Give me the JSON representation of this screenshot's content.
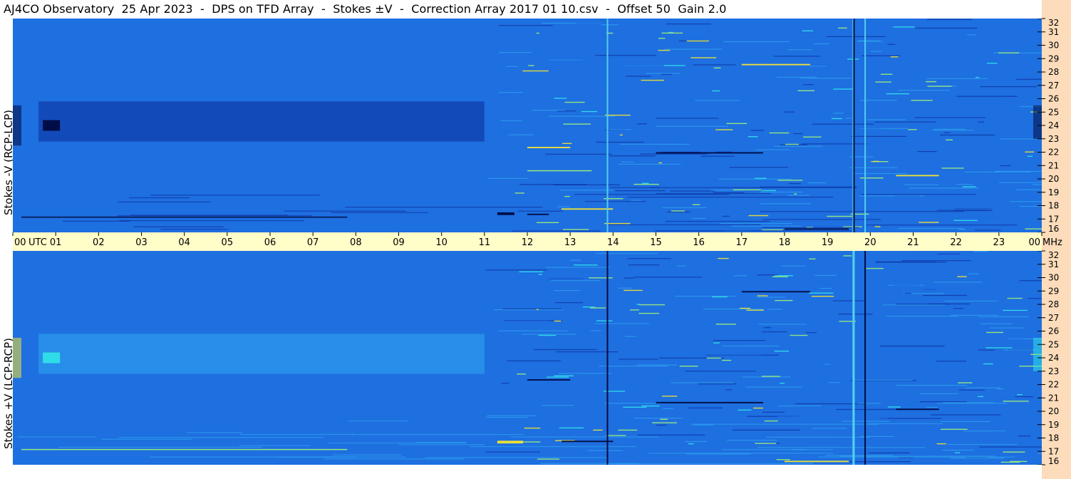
{
  "header": {
    "title": "AJ4CO Observatory  25 Apr 2023  -  DPS on TFD Array  -  Stokes ±V  -  Correction Array 2017 01 10.csv  -  Offset 50  Gain 2.0"
  },
  "colors": {
    "background_blue": "#1E6FE0",
    "right_strip": "#FCDCBA",
    "time_axis_band": "#FFFDC8",
    "feature_yellow": "#F4E430",
    "feature_cyan": "#30E0E8",
    "feature_dark": "#000A40"
  },
  "chart_data": [
    {
      "type": "heatmap",
      "ylabel": "Stokes -V (RCP-LCP)",
      "x": {
        "unit": "UTC",
        "range": [
          0,
          24
        ],
        "tick_labels": [
          "00",
          "01",
          "02",
          "03",
          "04",
          "05",
          "06",
          "07",
          "08",
          "09",
          "10",
          "11",
          "12",
          "13",
          "14",
          "15",
          "16",
          "17",
          "18",
          "19",
          "20",
          "21",
          "22",
          "23",
          "00"
        ]
      },
      "y": {
        "unit": "MHz",
        "range": [
          16,
          32
        ],
        "tick_labels": [
          "16",
          "17",
          "18",
          "19",
          "20",
          "21",
          "22",
          "23",
          "24",
          "25",
          "26",
          "27",
          "28",
          "29",
          "30",
          "31",
          "32"
        ]
      },
      "colormap": [
        "#000A40",
        "#0B2C9A",
        "#1E6FE0",
        "#2FA8F0",
        "#30E0E8",
        "#9EF078",
        "#F4E430"
      ],
      "vertical_lines_utc": [
        {
          "x": 13.87,
          "color": "#50D0F0"
        },
        {
          "x": 19.6,
          "color": "#50D0F0"
        },
        {
          "x": 19.62,
          "color": "#000A40"
        },
        {
          "x": 19.88,
          "color": "#50D0F0"
        }
      ],
      "features": [
        {
          "x0": 0.6,
          "x1": 11.0,
          "y0": 22.8,
          "y1": 25.8,
          "level": 1
        },
        {
          "x0": 0.7,
          "x1": 1.1,
          "y0": 23.6,
          "y1": 24.4,
          "level": 0
        },
        {
          "x0": 0.0,
          "x1": 0.2,
          "y0": 22.5,
          "y1": 25.5,
          "level": 0
        },
        {
          "x0": 23.8,
          "x1": 24.0,
          "y0": 23.0,
          "y1": 25.5,
          "level": 0
        },
        {
          "x0": 17.0,
          "x1": 18.6,
          "y0": 28.5,
          "y1": 28.6,
          "level": 6
        },
        {
          "x0": 20.6,
          "x1": 21.6,
          "y0": 20.2,
          "y1": 20.3,
          "level": 6
        },
        {
          "x0": 18.0,
          "x1": 19.5,
          "y0": 16.2,
          "y1": 16.3,
          "level": 0
        },
        {
          "x0": 11.3,
          "x1": 11.7,
          "y0": 17.3,
          "y1": 17.5,
          "level": 0
        },
        {
          "x0": 12.0,
          "x1": 12.5,
          "y0": 17.3,
          "y1": 17.4,
          "level": 0
        },
        {
          "x0": 0.2,
          "x1": 7.8,
          "y0": 17.1,
          "y1": 17.18,
          "level": 0
        },
        {
          "x0": 12.8,
          "x1": 14.0,
          "y0": 17.7,
          "y1": 17.8,
          "level": 6
        },
        {
          "x0": 12.0,
          "x1": 13.5,
          "y0": 20.6,
          "y1": 20.65,
          "level": 5
        },
        {
          "x0": 15.0,
          "x1": 17.5,
          "y0": 21.9,
          "y1": 22.0,
          "level": 0
        },
        {
          "x0": 12.0,
          "x1": 13.0,
          "y0": 22.3,
          "y1": 22.4,
          "level": 6
        }
      ]
    },
    {
      "type": "heatmap",
      "ylabel": "Stokes +V (LCP-RCP)",
      "x": {
        "unit": "UTC",
        "range": [
          0,
          24
        ],
        "tick_labels": [
          "00",
          "01",
          "02",
          "03",
          "04",
          "05",
          "06",
          "07",
          "08",
          "09",
          "10",
          "11",
          "12",
          "13",
          "14",
          "15",
          "16",
          "17",
          "18",
          "19",
          "20",
          "21",
          "22",
          "23",
          "00"
        ]
      },
      "y": {
        "unit": "MHz",
        "range": [
          16,
          32
        ],
        "tick_labels": [
          "16",
          "17",
          "18",
          "19",
          "20",
          "21",
          "22",
          "23",
          "24",
          "25",
          "26",
          "27",
          "28",
          "29",
          "30",
          "31",
          "32"
        ]
      },
      "colormap": [
        "#000A40",
        "#0B2C9A",
        "#1E6FE0",
        "#2FA8F0",
        "#30E0E8",
        "#9EF078",
        "#F4E430"
      ],
      "vertical_lines_utc": [
        {
          "x": 13.87,
          "color": "#000A40"
        },
        {
          "x": 19.6,
          "color": "#50D0F0"
        },
        {
          "x": 19.62,
          "color": "#50D0F0"
        },
        {
          "x": 19.88,
          "color": "#000A40"
        }
      ],
      "features": [
        {
          "x0": 0.6,
          "x1": 11.0,
          "y0": 22.8,
          "y1": 25.8,
          "level": 3
        },
        {
          "x0": 0.7,
          "x1": 1.1,
          "y0": 23.6,
          "y1": 24.4,
          "level": 4
        },
        {
          "x0": 0.0,
          "x1": 0.2,
          "y0": 22.5,
          "y1": 25.5,
          "level": 6
        },
        {
          "x0": 23.8,
          "x1": 24.0,
          "y0": 23.0,
          "y1": 25.5,
          "level": 4
        },
        {
          "x0": 17.0,
          "x1": 18.6,
          "y0": 28.9,
          "y1": 29.0,
          "level": 0
        },
        {
          "x0": 20.6,
          "x1": 21.6,
          "y0": 20.1,
          "y1": 20.2,
          "level": 0
        },
        {
          "x0": 18.0,
          "x1": 19.5,
          "y0": 16.2,
          "y1": 16.3,
          "level": 6
        },
        {
          "x0": 11.3,
          "x1": 11.9,
          "y0": 17.6,
          "y1": 17.8,
          "level": 6
        },
        {
          "x0": 0.2,
          "x1": 7.8,
          "y0": 17.1,
          "y1": 17.18,
          "level": 5
        },
        {
          "x0": 12.8,
          "x1": 14.0,
          "y0": 17.7,
          "y1": 17.8,
          "level": 0
        },
        {
          "x0": 15.0,
          "x1": 17.5,
          "y0": 20.6,
          "y1": 20.7,
          "level": 0
        },
        {
          "x0": 12.0,
          "x1": 13.0,
          "y0": 22.3,
          "y1": 22.4,
          "level": 0
        }
      ]
    }
  ]
}
